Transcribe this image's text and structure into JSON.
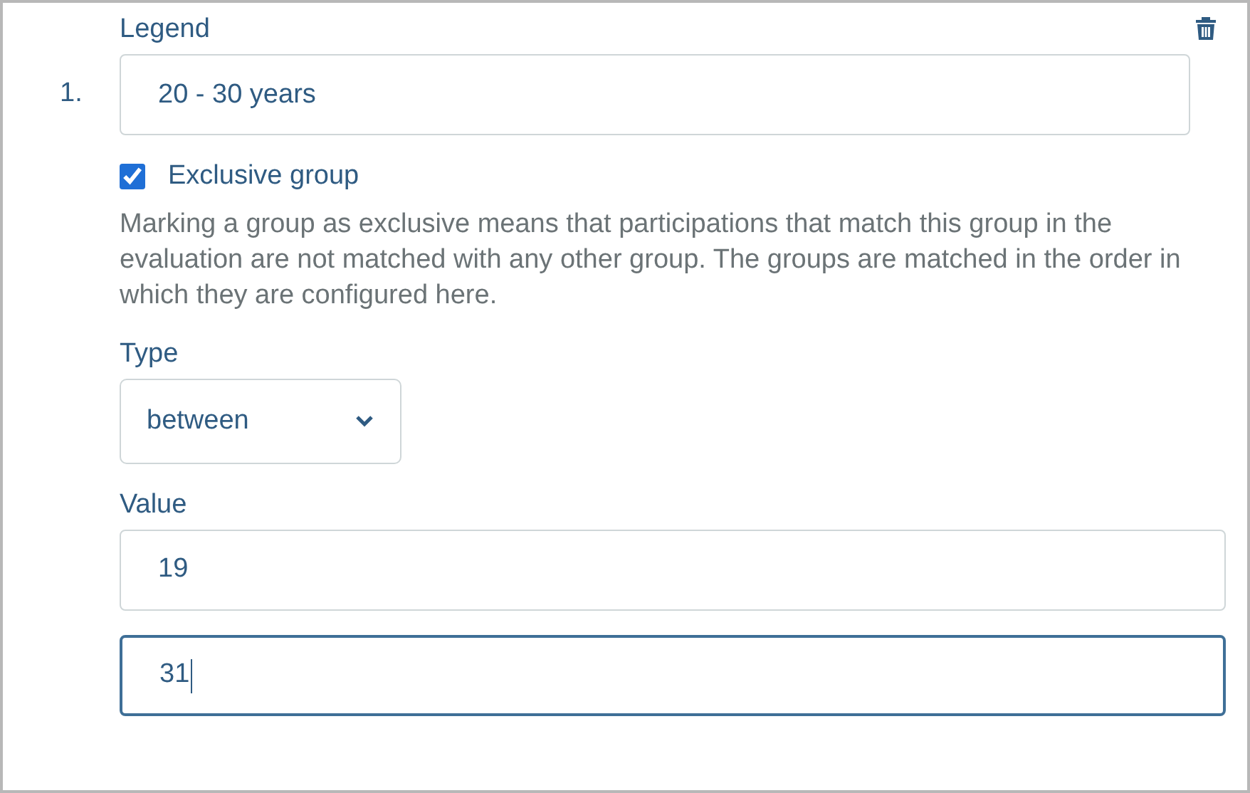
{
  "legend": {
    "label": "Legend",
    "number": "1.",
    "value": "20 - 30 years"
  },
  "exclusive": {
    "label": "Exclusive group",
    "checked": true,
    "description": "Marking a group as exclusive means that participations that match this group in the evaluation are not matched with any other group. The groups are matched in the order in which they are configured here."
  },
  "type": {
    "label": "Type",
    "value": "between"
  },
  "value": {
    "label": "Value",
    "fields": [
      {
        "value": "19",
        "focused": false
      },
      {
        "value": "31",
        "focused": true
      }
    ]
  }
}
